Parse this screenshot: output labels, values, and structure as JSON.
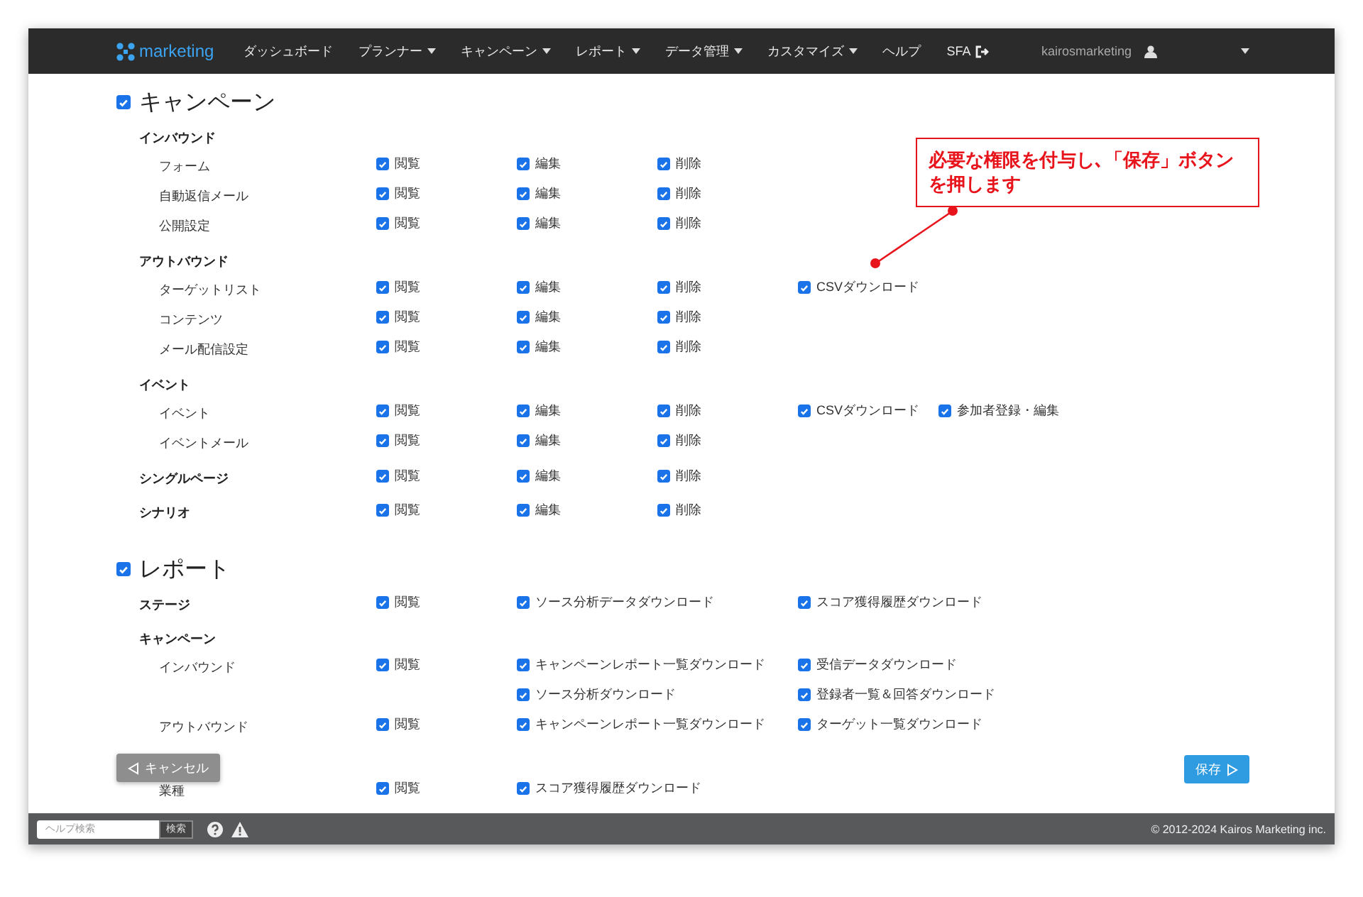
{
  "navbar": {
    "logo": "marketing",
    "menu": [
      {
        "label": "ダッシュボード",
        "dropdown": false
      },
      {
        "label": "プランナー",
        "dropdown": true
      },
      {
        "label": "キャンペーン",
        "dropdown": true
      },
      {
        "label": "レポート",
        "dropdown": true
      },
      {
        "label": "データ管理",
        "dropdown": true
      },
      {
        "label": "カスタマイズ",
        "dropdown": true
      },
      {
        "label": "ヘルプ",
        "dropdown": false
      },
      {
        "label": "SFA",
        "dropdown": false,
        "external": true
      }
    ],
    "account": "kairosmarketing"
  },
  "sections": [
    {
      "title": "キャンペーン",
      "checked": true,
      "kind": "crud",
      "groups": [
        {
          "label": "インバウンド",
          "rows": [
            {
              "label": "フォーム",
              "permissions": [
                {
                  "label": "閲覧",
                  "checked": true
                },
                {
                  "label": "編集",
                  "checked": true
                },
                {
                  "label": "削除",
                  "checked": true
                }
              ]
            },
            {
              "label": "自動返信メール",
              "permissions": [
                {
                  "label": "閲覧",
                  "checked": true
                },
                {
                  "label": "編集",
                  "checked": true
                },
                {
                  "label": "削除",
                  "checked": true
                }
              ]
            },
            {
              "label": "公開設定",
              "permissions": [
                {
                  "label": "閲覧",
                  "checked": true
                },
                {
                  "label": "編集",
                  "checked": true
                },
                {
                  "label": "削除",
                  "checked": true
                }
              ]
            }
          ]
        },
        {
          "label": "アウトバウンド",
          "rows": [
            {
              "label": "ターゲットリスト",
              "permissions": [
                {
                  "label": "閲覧",
                  "checked": true
                },
                {
                  "label": "編集",
                  "checked": true
                },
                {
                  "label": "削除",
                  "checked": true
                },
                {
                  "label": "CSVダウンロード",
                  "checked": true
                }
              ]
            },
            {
              "label": "コンテンツ",
              "permissions": [
                {
                  "label": "閲覧",
                  "checked": true
                },
                {
                  "label": "編集",
                  "checked": true
                },
                {
                  "label": "削除",
                  "checked": true
                }
              ]
            },
            {
              "label": "メール配信設定",
              "permissions": [
                {
                  "label": "閲覧",
                  "checked": true
                },
                {
                  "label": "編集",
                  "checked": true
                },
                {
                  "label": "削除",
                  "checked": true
                }
              ]
            }
          ]
        },
        {
          "label": "イベント",
          "rows": [
            {
              "label": "イベント",
              "permissions": [
                {
                  "label": "閲覧",
                  "checked": true
                },
                {
                  "label": "編集",
                  "checked": true
                },
                {
                  "label": "削除",
                  "checked": true
                },
                {
                  "label": "CSVダウンロード",
                  "checked": true
                },
                {
                  "label": "参加者登録・編集",
                  "checked": true
                }
              ]
            },
            {
              "label": "イベントメール",
              "permissions": [
                {
                  "label": "閲覧",
                  "checked": true
                },
                {
                  "label": "編集",
                  "checked": true
                },
                {
                  "label": "削除",
                  "checked": true
                }
              ]
            }
          ]
        },
        {
          "label": "シングルページ",
          "permissions": [
            {
              "label": "閲覧",
              "checked": true
            },
            {
              "label": "編集",
              "checked": true
            },
            {
              "label": "削除",
              "checked": true
            }
          ]
        },
        {
          "label": "シナリオ",
          "permissions": [
            {
              "label": "閲覧",
              "checked": true
            },
            {
              "label": "編集",
              "checked": true
            },
            {
              "label": "削除",
              "checked": true
            }
          ]
        }
      ]
    },
    {
      "title": "レポート",
      "checked": true,
      "kind": "download",
      "groups": [
        {
          "label": "ステージ",
          "view": {
            "label": "閲覧",
            "checked": true
          },
          "downloads": [
            {
              "label": "ソース分析データダウンロード",
              "checked": true
            },
            {
              "label": "スコア獲得履歴ダウンロード",
              "checked": true
            }
          ]
        },
        {
          "label": "キャンペーン",
          "rows": [
            {
              "label": "インバウンド",
              "view": {
                "label": "閲覧",
                "checked": true
              },
              "downloads": [
                {
                  "label": "キャンペーンレポート一覧ダウンロード",
                  "checked": true
                },
                {
                  "label": "受信データダウンロード",
                  "checked": true
                }
              ]
            },
            {
              "downloads": [
                {
                  "label": "ソース分析ダウンロード",
                  "checked": true
                },
                {
                  "label": "登録者一覧＆回答ダウンロード",
                  "checked": true
                }
              ]
            },
            {
              "label": "アウトバウンド",
              "view": {
                "label": "閲覧",
                "checked": true
              },
              "downloads": [
                {
                  "label": "キャンペーンレポート一覧ダウンロード",
                  "checked": true
                },
                {
                  "label": "ターゲット一覧ダウンロード",
                  "checked": true
                }
              ]
            }
          ]
        },
        {
          "rows": [
            {
              "label": "業種",
              "view": {
                "label": "閲覧",
                "checked": true
              },
              "downloads": [
                {
                  "label": "スコア獲得履歴ダウンロード",
                  "checked": true
                }
              ]
            }
          ]
        }
      ]
    }
  ],
  "callout": "必要な権限を付与し､「保存」ボタンを押します",
  "buttons": {
    "cancel": "キャンセル",
    "save": "保存"
  },
  "footer": {
    "search_placeholder": "ヘルプ検索",
    "search_button": "検索",
    "copyright": "© 2012-2024 Kairos Marketing inc."
  }
}
